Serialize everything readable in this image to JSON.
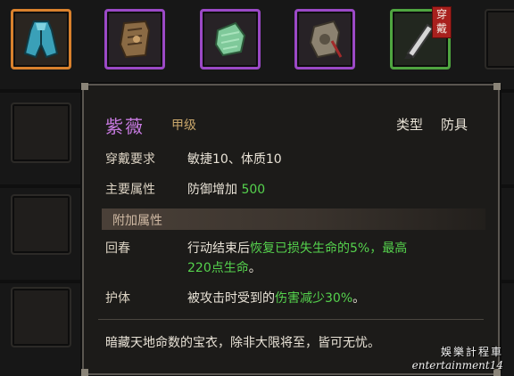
{
  "equip_badge": "穿戴",
  "item": {
    "name": "紫薇",
    "grade": "甲级",
    "type_label": "类型",
    "type_value": "防具",
    "rows": {
      "req_label": "穿戴要求",
      "req_value": "敏捷10、体质10",
      "main_label": "主要属性",
      "main_value": "防御增加",
      "main_number": "500"
    },
    "section_title": "附加属性",
    "effects": [
      {
        "label": "回春",
        "text_plain": "行动结束后",
        "text_green": "恢复已损失生命的5%，最高",
        "line2_green": "220点生命",
        "line2_plain": "。"
      },
      {
        "label": "护体",
        "text_plain": "被攻击时受到的",
        "text_green": "伤害减少30%",
        "text_end": "。"
      }
    ],
    "description": "暗藏天地命数的宝衣，除非大限将至，皆可无忧。"
  },
  "watermark": {
    "cn": "娛樂計程車",
    "en": "entertainment14"
  },
  "colors": {
    "rarity_purple": "#c77ae0",
    "bonus_green": "#55d24d",
    "slot_orange": "#d9812d",
    "slot_purple": "#9b49c6",
    "slot_green": "#4fa540"
  }
}
